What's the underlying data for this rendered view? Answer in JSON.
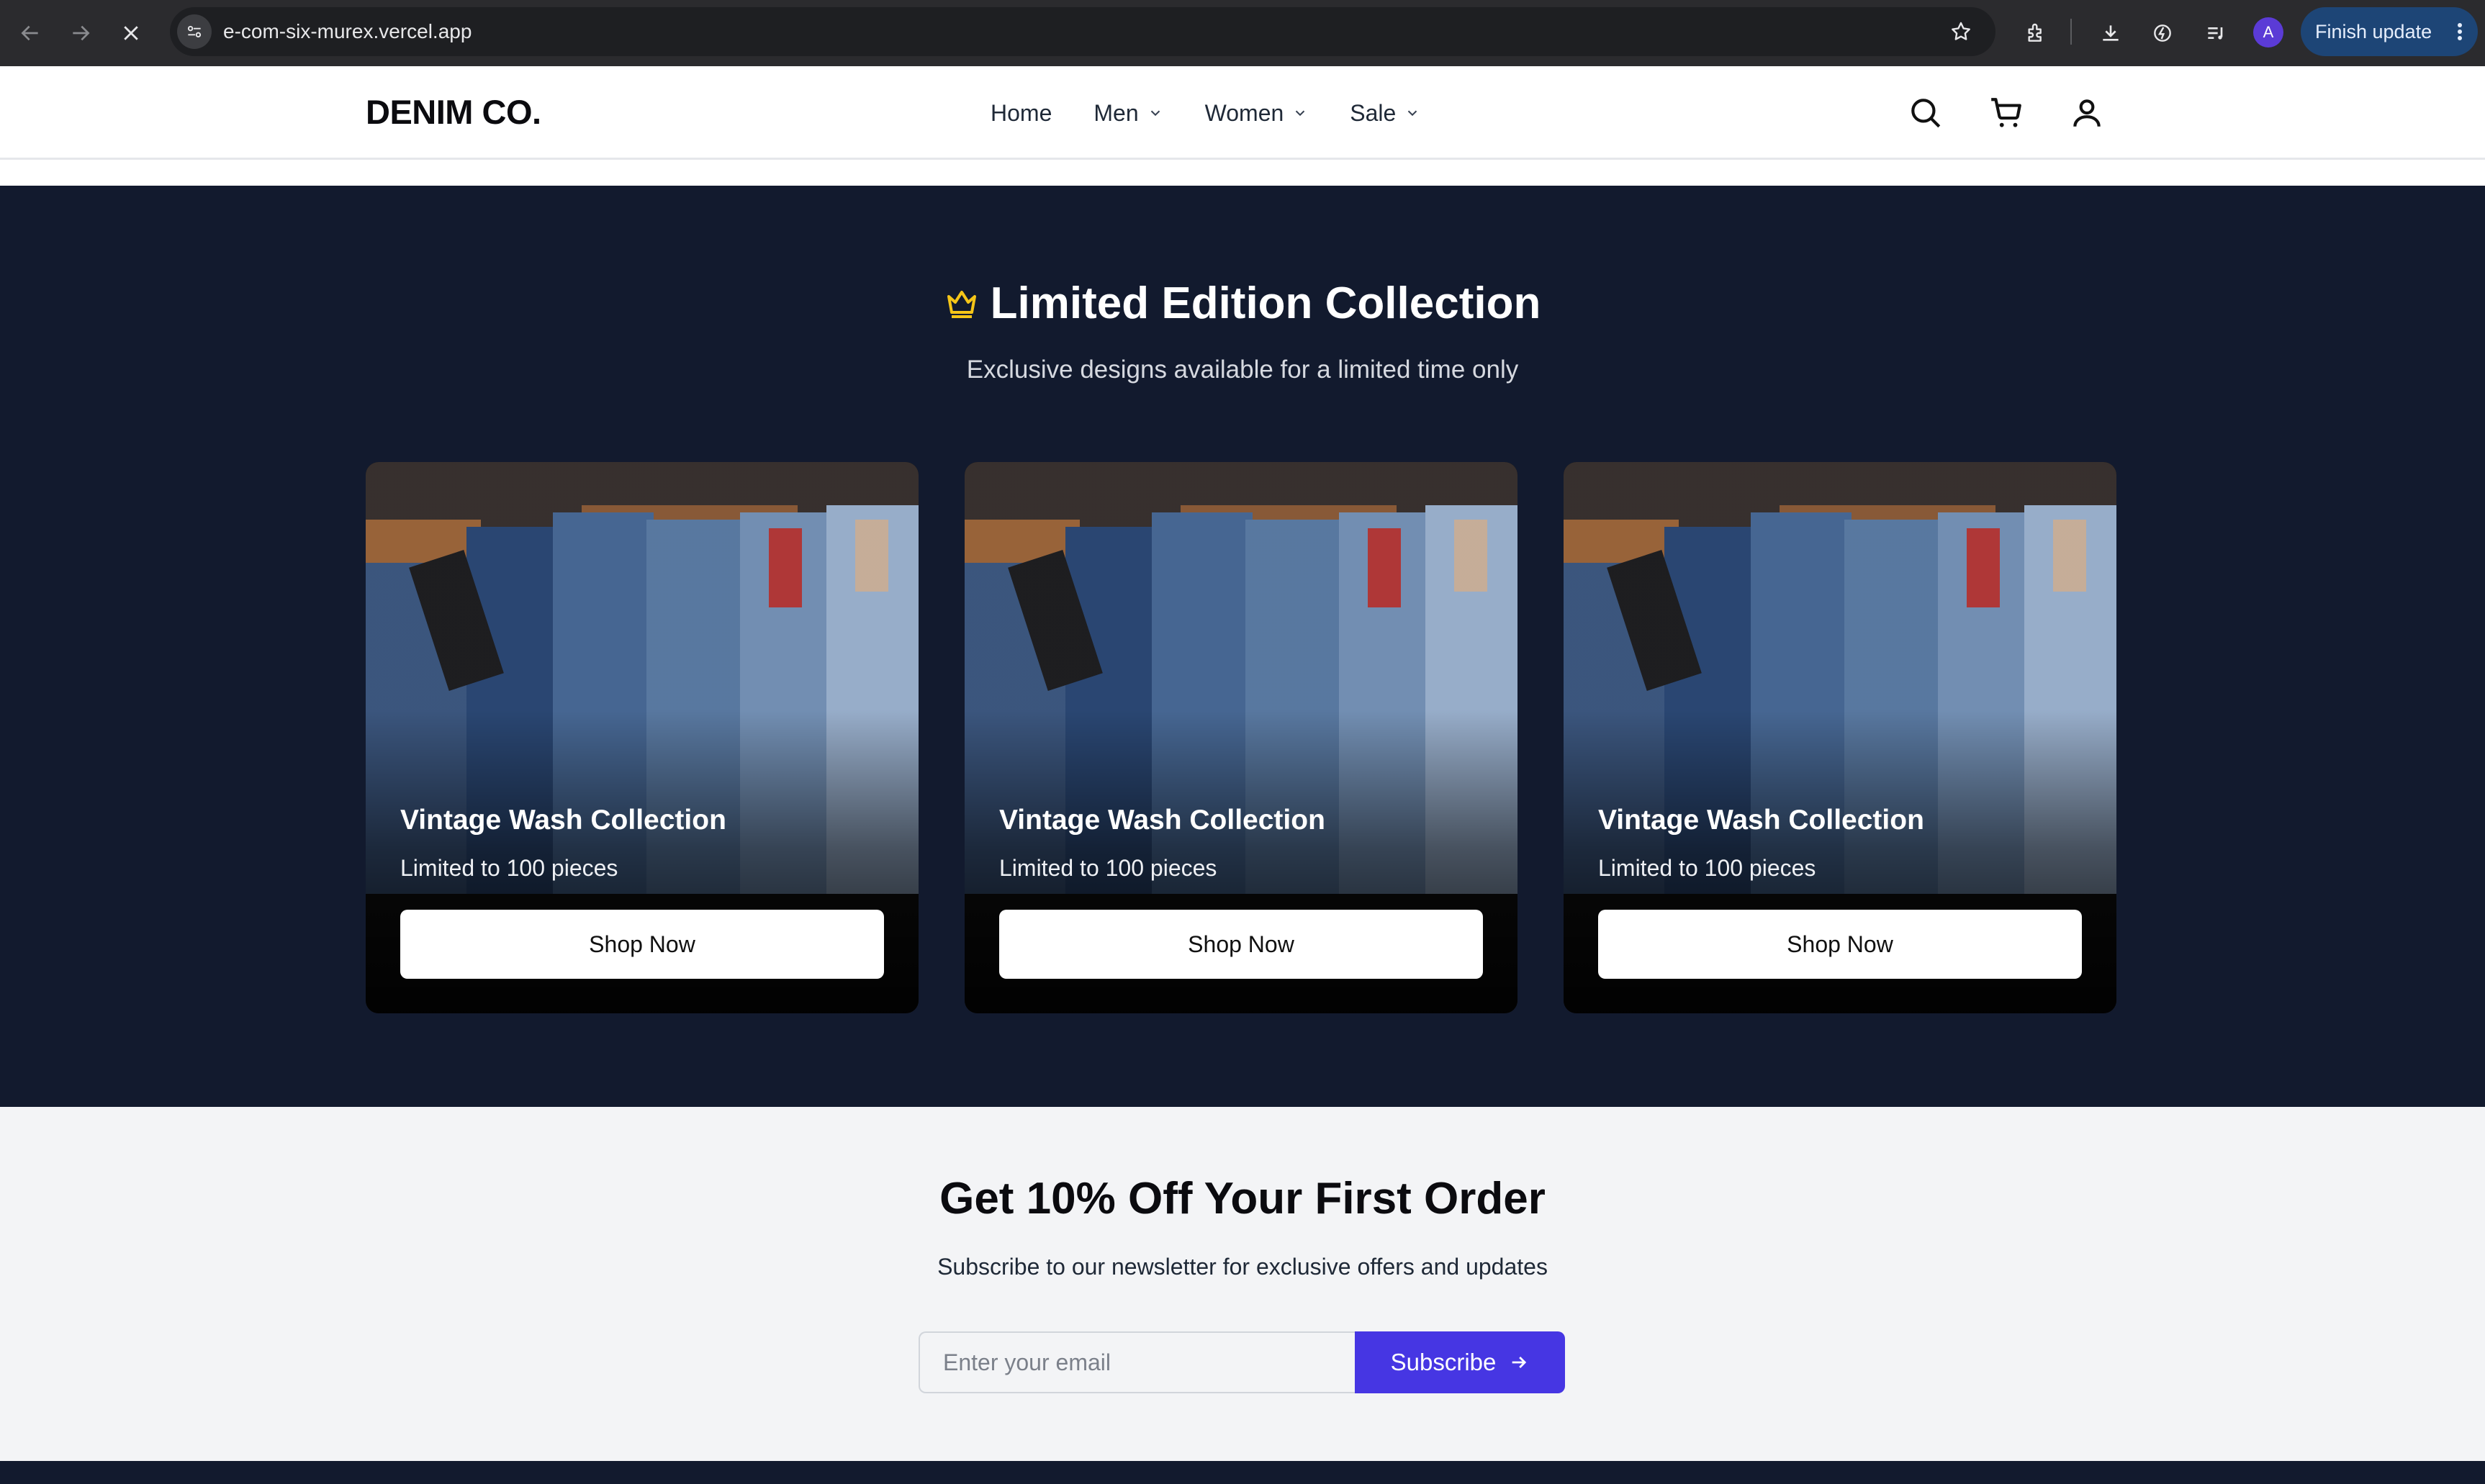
{
  "browser": {
    "url": "e-com-six-murex.vercel.app",
    "profile_initial": "A",
    "update_label": "Finish update"
  },
  "header": {
    "logo": "DENIM CO.",
    "nav": [
      {
        "label": "Home",
        "has_dropdown": false
      },
      {
        "label": "Men",
        "has_dropdown": true
      },
      {
        "label": "Women",
        "has_dropdown": true
      },
      {
        "label": "Sale",
        "has_dropdown": true
      }
    ],
    "icons": [
      "search-icon",
      "cart-icon",
      "user-icon"
    ]
  },
  "limited": {
    "title": "Limited Edition Collection",
    "subtitle": "Exclusive designs available for a limited time only",
    "accent_color": "#f5c518",
    "background": "#121a2e",
    "cards": [
      {
        "title": "Vintage Wash Collection",
        "subtitle": "Limited to 100 pieces",
        "button": "Shop Now"
      },
      {
        "title": "Vintage Wash Collection",
        "subtitle": "Limited to 100 pieces",
        "button": "Shop Now"
      },
      {
        "title": "Vintage Wash Collection",
        "subtitle": "Limited to 100 pieces",
        "button": "Shop Now"
      }
    ]
  },
  "newsletter": {
    "title": "Get 10% Off Your First Order",
    "subtitle": "Subscribe to our newsletter for exclusive offers and updates",
    "email_placeholder": "Enter your email",
    "subscribe_label": "Subscribe",
    "button_color": "#4636e3"
  }
}
